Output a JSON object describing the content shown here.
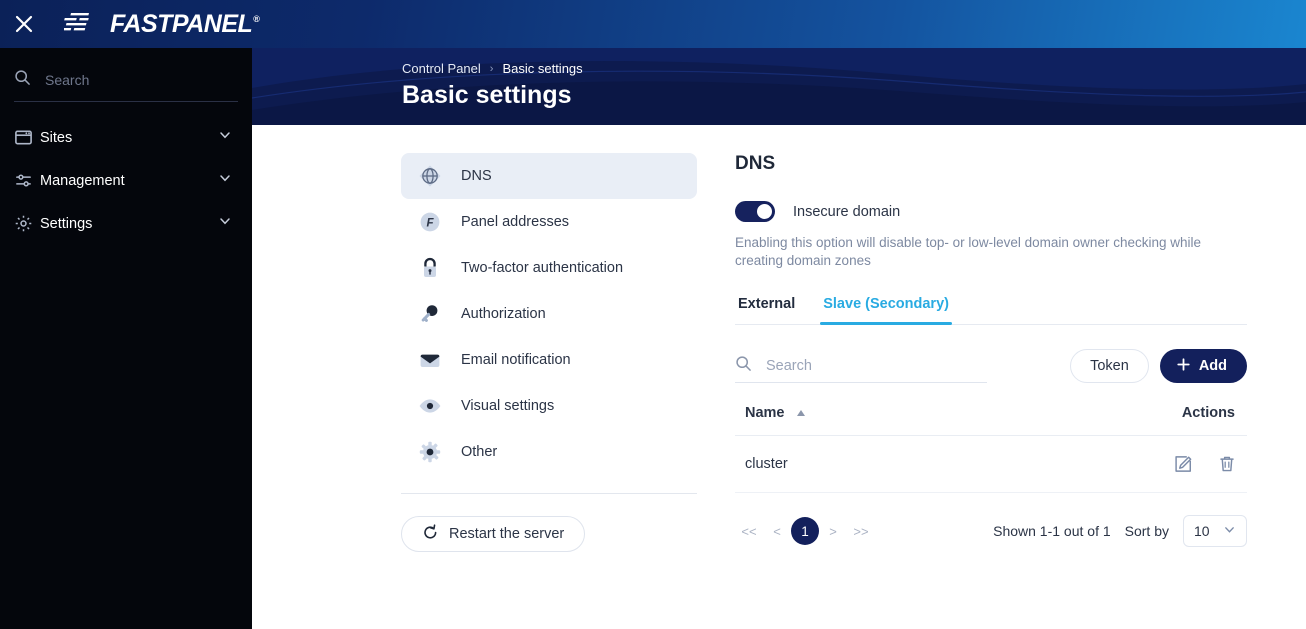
{
  "topbar": {
    "close_icon": "close-icon",
    "logo_mark_icon": "fastpanel-speedlines-icon",
    "brand": "FASTPANEL",
    "brand_registered": "®"
  },
  "sidebar": {
    "search": {
      "placeholder": "Search",
      "value": "",
      "icon": "search-icon"
    },
    "items": [
      {
        "label": "Sites",
        "icon": "browser-window-icon",
        "chevron": "chevron-down-icon"
      },
      {
        "label": "Management",
        "icon": "sliders-icon",
        "chevron": "chevron-down-icon"
      },
      {
        "label": "Settings",
        "icon": "gear-icon",
        "chevron": "chevron-down-icon"
      }
    ]
  },
  "banner": {
    "breadcrumb": {
      "root": "Control Panel",
      "separator": "›",
      "current": "Basic settings"
    },
    "title": "Basic settings"
  },
  "settings_menu": {
    "items": [
      {
        "label": "DNS",
        "icon": "globe-icon",
        "active": true
      },
      {
        "label": "Panel addresses",
        "icon": "f-badge-icon",
        "active": false
      },
      {
        "label": "Two-factor authentication",
        "icon": "lock-icon",
        "active": false
      },
      {
        "label": "Authorization",
        "icon": "key-icon",
        "active": false
      },
      {
        "label": "Email notification",
        "icon": "envelope-icon",
        "active": false
      },
      {
        "label": "Visual settings",
        "icon": "eye-icon",
        "active": false
      },
      {
        "label": "Other",
        "icon": "gear-icon",
        "active": false
      }
    ],
    "restart_button": {
      "label": "Restart the server",
      "icon": "restart-icon"
    }
  },
  "panel": {
    "title": "DNS",
    "toggle": {
      "label": "Insecure domain",
      "state": "on"
    },
    "hint": "Enabling this option will disable top- or low-level domain owner checking while creating domain zones",
    "tabs": [
      {
        "label": "External",
        "active": false
      },
      {
        "label": "Slave (Secondary)",
        "active": true
      }
    ],
    "toolbar": {
      "search": {
        "placeholder": "Search",
        "value": "",
        "icon": "search-icon"
      },
      "token_label": "Token",
      "add_label": "Add",
      "add_icon": "plus-icon"
    },
    "table": {
      "columns": [
        "Name",
        "Actions"
      ],
      "sort_direction": "asc",
      "rows": [
        {
          "name": "cluster",
          "actions": [
            "edit-icon",
            "delete-icon"
          ]
        }
      ]
    },
    "pagination": {
      "first": "<<",
      "prev": "<",
      "pages": [
        "1"
      ],
      "current_page": "1",
      "next": ">",
      "last": ">>",
      "shown": "Shown 1-1 out of 1",
      "sort_by_label": "Sort by",
      "page_size": "10",
      "page_size_chevron": "chevron-down-icon"
    }
  },
  "colors": {
    "brand_navy": "#13205c",
    "accent_blue": "#29abe2",
    "sidebar_bg": "#04060c",
    "banner_bg": "#0d1b4f",
    "active_item_bg": "#e9eef6"
  }
}
